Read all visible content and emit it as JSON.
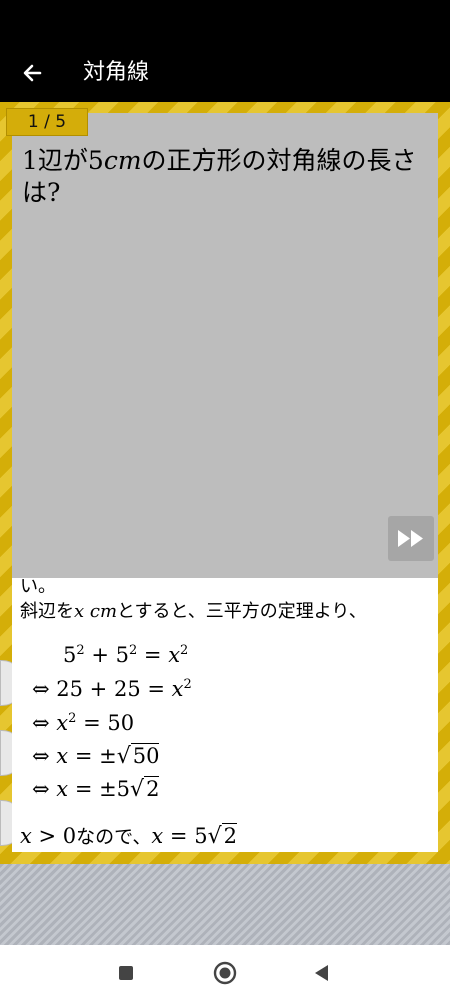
{
  "app_bar": {
    "title": "対角線",
    "back_icon": "arrow-left-icon"
  },
  "counter": "1 / 5",
  "question": {
    "part1": "1辺が",
    "num": "5",
    "unit": "cm",
    "part2": "の正方形の対角線の長さは?"
  },
  "explanation": {
    "line_partial": "い。",
    "line_intro_a": "斜辺を",
    "line_intro_var": "x cm",
    "line_intro_b": "とすると、三平方の定理より、",
    "eq1_lhs": "5",
    "eq1_mid": " + 5",
    "eq1_rhs": " = ",
    "eq1_x": "x",
    "exp2": "2",
    "iff": "⇔",
    "eq2_text": " 25 + 25 = ",
    "eq2_x": "x",
    "eq3_x": "x",
    "eq3_rhs": " = 50",
    "eq4_x": "x",
    "eq4_mid": " = ±",
    "eq4_rad": "50",
    "eq5_x": "x",
    "eq5_mid": " = ±5",
    "eq5_rad": "2",
    "conclusion_x1": "x",
    "conclusion_gt": " > 0",
    "conclusion_text": "なので、",
    "conclusion_x2": "x",
    "conclusion_eq": " = 5",
    "conclusion_rad": "2"
  },
  "controls": {
    "skip_icon": "fast-forward-icon"
  },
  "nav": {
    "recent_icon": "square-icon",
    "home_icon": "circle-home-icon",
    "back_icon": "triangle-back-icon"
  },
  "colors": {
    "board": "#d9b511",
    "card": "#bdbdbd",
    "badge": "#d4ad0a"
  }
}
